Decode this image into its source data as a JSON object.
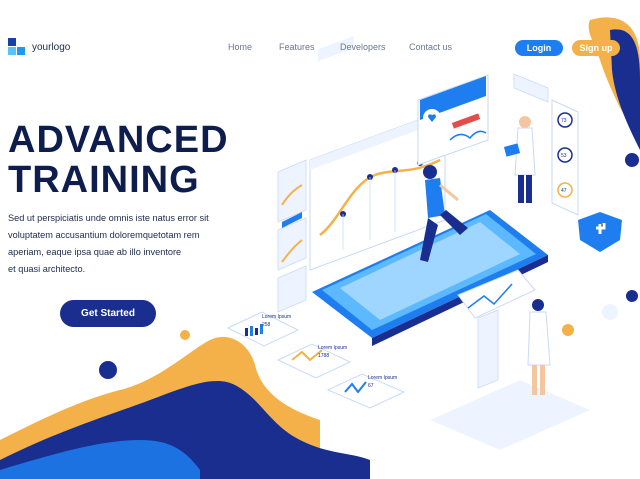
{
  "header": {
    "logo_text": "yourlogo",
    "nav": [
      {
        "label": "Home"
      },
      {
        "label": "Features"
      },
      {
        "label": "Developers"
      },
      {
        "label": "Contact us"
      }
    ],
    "login_label": "Login",
    "signup_label": "Sign up"
  },
  "hero": {
    "title_line1": "ADVANCED",
    "title_line2": "TRAINING",
    "body_lines": [
      "Sed ut perspiciatis unde omnis iste natus error sit",
      "voluptatem accusantium doloremquetotam rem",
      "aperiam, eaque ipsa quae ab illo inventore",
      "et quasi architecto."
    ],
    "cta_label": "Get Started"
  },
  "illustration": {
    "cards": [
      {
        "label": "Lorem Ipsum",
        "value": "258"
      },
      {
        "label": "Lorem Ipsum",
        "value": "1788"
      },
      {
        "label": "Lorem Ipsum",
        "value": "67"
      }
    ],
    "side_stats": [
      "73",
      "53",
      "47"
    ],
    "colors": {
      "navy": "#1a2e8f",
      "blue": "#1e7ef0",
      "light_blue": "#5cb8ff",
      "orange": "#f4b14a",
      "panel": "#eef4ff"
    }
  }
}
